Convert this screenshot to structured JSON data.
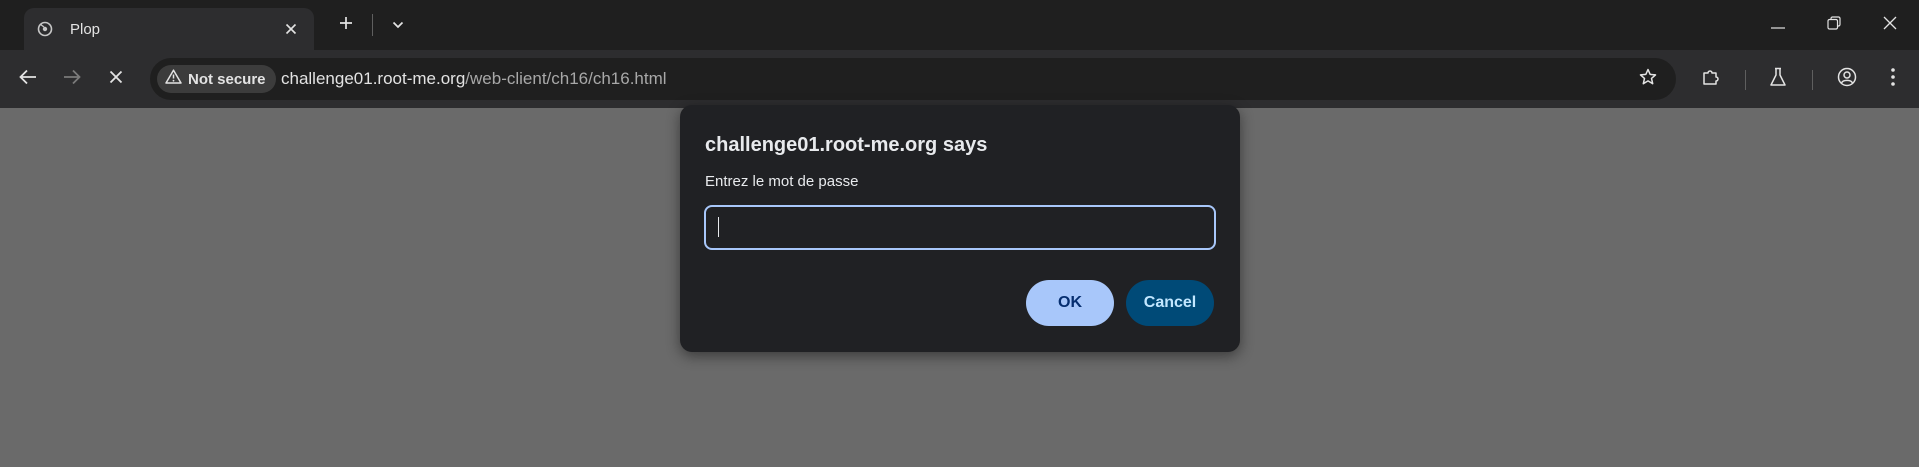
{
  "tab": {
    "title": "Plop",
    "favicon": "page-favicon-icon",
    "close_icon": "close-icon"
  },
  "tabstrip": {
    "new_tab_icon": "plus-icon",
    "tab_search_icon": "chevron-down-icon"
  },
  "window_controls": {
    "minimize_icon": "minimize-icon",
    "restore_icon": "restore-icon",
    "close_icon": "close-icon"
  },
  "toolbar": {
    "back_icon": "arrow-left-icon",
    "forward_icon": "arrow-right-icon",
    "stop_icon": "close-icon",
    "extensions_icon": "puzzle-icon",
    "labs_icon": "flask-icon",
    "profile_icon": "account-circle-icon",
    "menu_icon": "kebab-menu-icon"
  },
  "omnibox": {
    "security_label": "Not secure",
    "security_icon": "warning-triangle-icon",
    "url_host": "challenge01.root-me.org",
    "url_path": "/web-client/ch16/ch16.html",
    "bookmark_icon": "star-icon"
  },
  "dialog": {
    "title": "challenge01.root-me.org says",
    "message": "Entrez le mot de passe",
    "input_value": "",
    "ok_label": "OK",
    "cancel_label": "Cancel"
  },
  "colors": {
    "page_background": "#6a6a6a",
    "dialog_background": "#202124",
    "ok_button": "#a8c7fa",
    "cancel_button": "#004a77",
    "input_focus_border": "#a8c7fa"
  }
}
